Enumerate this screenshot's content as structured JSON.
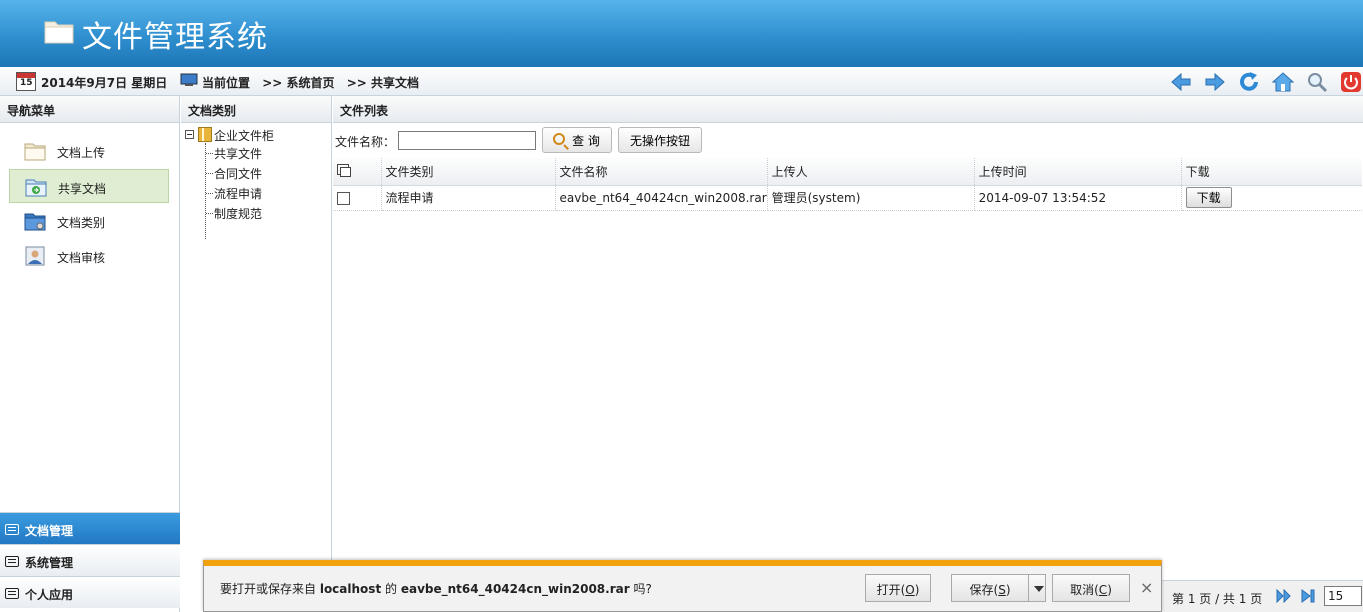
{
  "header": {
    "title": "文件管理系统"
  },
  "toolbar": {
    "calendar_day": "15",
    "date": "2014年9月7日 星期日",
    "breadcrumb": [
      "当前位置",
      ">> 系统首页",
      ">> 共享文档"
    ],
    "icons": [
      "back-arrow-icon",
      "forward-arrow-icon",
      "refresh-icon",
      "home-icon",
      "search-icon",
      "power-icon"
    ]
  },
  "leftnav": {
    "title": "导航菜单",
    "items": [
      {
        "label": "文档上传",
        "icon": "folder-upload-icon",
        "active": false
      },
      {
        "label": "共享文档",
        "icon": "shared-folder-icon",
        "active": true
      },
      {
        "label": "文档类别",
        "icon": "folder-category-icon",
        "active": false
      },
      {
        "label": "文档审核",
        "icon": "user-review-icon",
        "active": false
      }
    ],
    "accordion": [
      {
        "label": "文档管理",
        "active": true
      },
      {
        "label": "系统管理",
        "active": false
      },
      {
        "label": "个人应用",
        "active": false
      }
    ]
  },
  "tree": {
    "title": "文档类别",
    "root": "企业文件柜",
    "children": [
      "共享文件",
      "合同文件",
      "流程申请",
      "制度规范"
    ]
  },
  "main": {
    "title": "文件列表",
    "search": {
      "label": "文件名称：",
      "value": "",
      "query_label": "查 询",
      "noop_label": "无操作按钮"
    },
    "columns": [
      "文件类别",
      "文件名称",
      "上传人",
      "上传时间",
      "下载"
    ],
    "rows": [
      {
        "category": "流程申请",
        "filename": "eavbe_nt64_40424cn_win2008.rar",
        "uploader": "管理员(system)",
        "time": "2014-09-07 13:54:52",
        "download": "下载"
      }
    ]
  },
  "pager": {
    "text": "第 1 页 / 共 1 页",
    "page_size": "15"
  },
  "notification": {
    "prefix": "要打开或保存来自 ",
    "host": "localhost",
    "middle": " 的 ",
    "file": "eavbe_nt64_40424cn_win2008.rar",
    "suffix": " 吗?",
    "open_label": "打开(",
    "open_key": "O",
    "save_label": "保存(",
    "save_key": "S",
    "cancel_label": "取消(",
    "cancel_key": "C",
    "close_paren": ")",
    "close_glyph": "×"
  },
  "colors": {
    "header_blue": "#2f8fcf",
    "active_nav": "#dfeed3",
    "accordion_active": "#2279c3",
    "notify_bar": "#f3a20c"
  }
}
